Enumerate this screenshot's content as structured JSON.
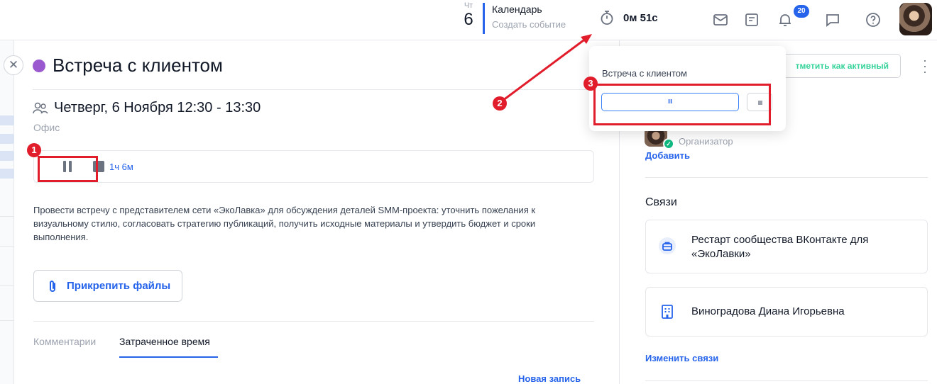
{
  "header": {
    "day_of_week": "Чт",
    "day_number": "6",
    "calendar_title": "Календарь",
    "create_event": "Создать событие",
    "timer_value": "0м 51с",
    "notifications_count": "20"
  },
  "main": {
    "title": "Встреча с клиентом",
    "datetime": "Четверг, 6 Ноября 12:30 - 13:30",
    "place": "Офис",
    "elapsed": "1ч 6м",
    "description": "Провести встречу с представителем сети «ЭкоЛавка» для обсуждения деталей SMM-проекта: уточнить пожелания к визуальному стилю, согласовать стратегию публикаций, получить исходные материалы и утвердить бюджет и сроки выполнения.",
    "attach_label": "Прикрепить файлы",
    "tabs": [
      {
        "label": "Комментарии"
      },
      {
        "label": "Затраченное время"
      }
    ],
    "new_record": "Новая запись"
  },
  "right": {
    "mark_active_label": "тметить как активный",
    "organizer_role": "Организатор",
    "add_label": "Добавить",
    "links_title": "Связи",
    "links": [
      {
        "text": "Рестарт сообщества ВКонтакте для «ЭкоЛавки»"
      },
      {
        "text": "Виноградова Диана Игорьевна"
      }
    ],
    "edit_links": "Изменить связи"
  },
  "popup": {
    "title": "Встреча с клиентом",
    "pause_symbol": "ıı"
  },
  "annotations": {
    "markers": [
      "1",
      "2",
      "3"
    ],
    "highlight_color": "#e11d2b"
  },
  "colors": {
    "accent": "#2563eb",
    "event_dot": "#9b59d0",
    "active_green": "#34d399"
  }
}
